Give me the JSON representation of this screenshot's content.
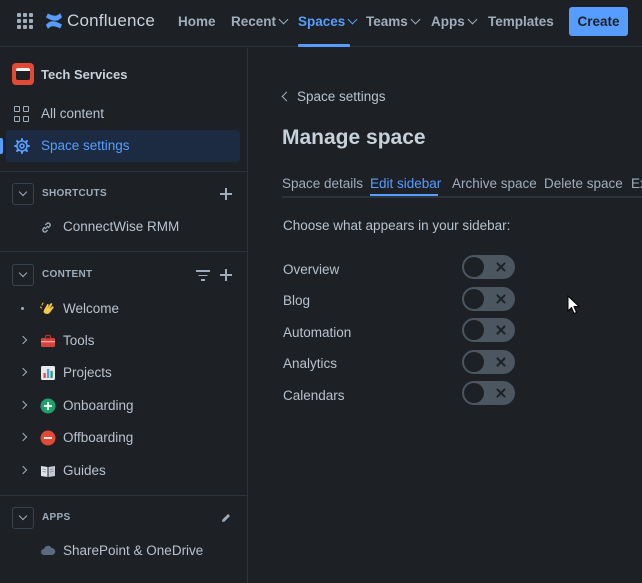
{
  "topnav": {
    "logo_text": "Confluence",
    "items": [
      {
        "label": "Home",
        "dropdown": false
      },
      {
        "label": "Recent",
        "dropdown": true
      },
      {
        "label": "Spaces",
        "dropdown": true,
        "active": true
      },
      {
        "label": "Teams",
        "dropdown": true
      },
      {
        "label": "Apps",
        "dropdown": true
      },
      {
        "label": "Templates",
        "dropdown": false
      }
    ],
    "create_label": "Create"
  },
  "sidebar": {
    "space_name": "Tech Services",
    "nav": [
      {
        "label": "All content",
        "icon": "grid-icon"
      },
      {
        "label": "Space settings",
        "icon": "gear-icon",
        "selected": true
      }
    ],
    "shortcuts": {
      "title": "SHORTCUTS",
      "items": [
        {
          "label": "ConnectWise RMM",
          "icon": "link-icon"
        }
      ]
    },
    "content": {
      "title": "CONTENT",
      "items": [
        {
          "label": "Welcome",
          "icon": "waving-hand-icon",
          "expandable": false
        },
        {
          "label": "Tools",
          "icon": "toolbox-icon",
          "expandable": true
        },
        {
          "label": "Projects",
          "icon": "bar-chart-icon",
          "expandable": true
        },
        {
          "label": "Onboarding",
          "icon": "green-plus-icon",
          "expandable": true
        },
        {
          "label": "Offboarding",
          "icon": "red-minus-icon",
          "expandable": true
        },
        {
          "label": "Guides",
          "icon": "book-icon",
          "expandable": true
        }
      ]
    },
    "apps": {
      "title": "APPS",
      "items": [
        {
          "label": "SharePoint & OneDrive",
          "icon": "cloud-icon"
        }
      ]
    }
  },
  "main": {
    "back_label": "Space settings",
    "title": "Manage space",
    "tabs": [
      {
        "label": "Space details"
      },
      {
        "label": "Edit sidebar",
        "active": true
      },
      {
        "label": "Archive space"
      },
      {
        "label": "Delete space"
      },
      {
        "label": "Ex"
      }
    ],
    "prompt": "Choose what appears in your sidebar:",
    "options": [
      {
        "label": "Overview",
        "enabled": false
      },
      {
        "label": "Blog",
        "enabled": false
      },
      {
        "label": "Automation",
        "enabled": false
      },
      {
        "label": "Analytics",
        "enabled": false
      },
      {
        "label": "Calendars",
        "enabled": false
      }
    ]
  },
  "colors": {
    "background": "#1d2125",
    "accent": "#579dff",
    "text": "#b6c2cf",
    "toggle_off": "#4b5660"
  }
}
